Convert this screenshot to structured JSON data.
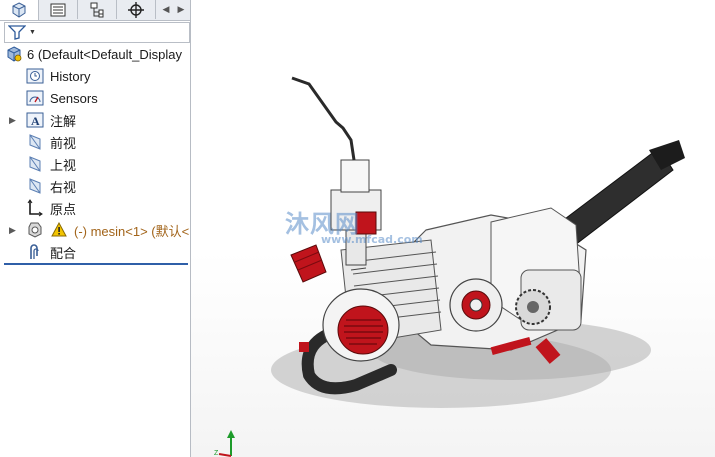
{
  "tabs": [
    {
      "name": "feature-manager",
      "icon": "feature-manager-icon"
    },
    {
      "name": "property-manager",
      "icon": "property-manager-icon"
    },
    {
      "name": "configuration-manager",
      "icon": "configuration-manager-icon"
    },
    {
      "name": "dimxpert-manager",
      "icon": "crosshair-icon"
    }
  ],
  "tree": {
    "root_label": "6  (Default<Default_Display",
    "items": [
      {
        "label": "History",
        "icon": "history-icon"
      },
      {
        "label": "Sensors",
        "icon": "sensors-icon"
      },
      {
        "label": "注解",
        "icon": "annotations-icon"
      },
      {
        "label": "前视",
        "icon": "plane-icon"
      },
      {
        "label": "上视",
        "icon": "plane-icon"
      },
      {
        "label": "右视",
        "icon": "plane-icon"
      },
      {
        "label": "原点",
        "icon": "origin-icon"
      },
      {
        "label": "(-) mesin<1> (默认<",
        "icon": "part-warning-icon"
      },
      {
        "label": "配合",
        "icon": "mates-icon"
      }
    ]
  },
  "watermark": {
    "text": "沐风网",
    "sub": "www.mfcad.com"
  },
  "colors": {
    "accent_blue": "#2f5fa8",
    "part_red": "#c0141c",
    "warning_yellow": "#f2c400"
  }
}
